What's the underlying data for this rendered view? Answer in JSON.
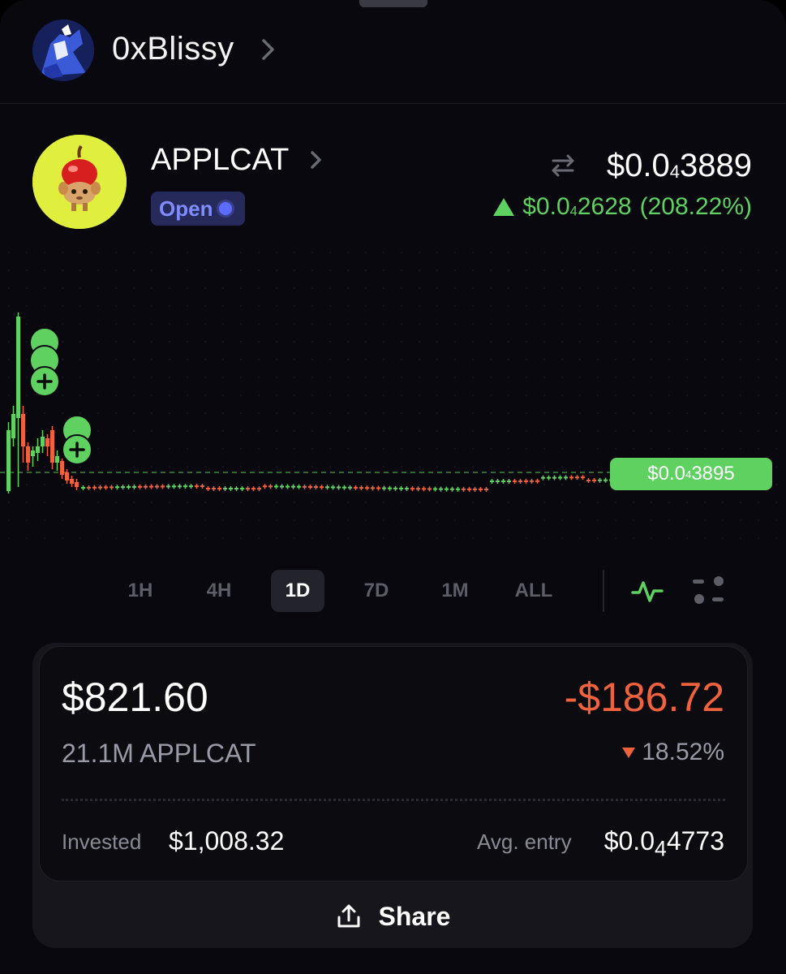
{
  "header": {
    "username": "0xBlissy",
    "avatar_icon": "user-avatar",
    "chevron_icon": "chevron-right-icon"
  },
  "token": {
    "name": "APPLCAT",
    "status": "Open",
    "logo_icon": "apple-cat-token-logo",
    "price_prefix": "$0.0",
    "price_zeros": "4",
    "price_digits": "3889",
    "change_prefix": "$0.0",
    "change_zeros": "4",
    "change_digits": "2628",
    "change_pct": "(208.22%)",
    "change_direction": "up"
  },
  "chart_data": {
    "type": "candlestick",
    "current_price_label_prefix": "$0.0",
    "current_price_label_zeros": "4",
    "current_price_label_digits": "3895",
    "buy_marker_count": 5,
    "up_color": "#5ed160",
    "down_color": "#f0623e"
  },
  "ranges": {
    "items": [
      "1H",
      "4H",
      "1D",
      "7D",
      "1M",
      "ALL"
    ],
    "active": "1D"
  },
  "position": {
    "value": "$821.60",
    "pnl": "-$186.72",
    "holdings": "21.1M APPLCAT",
    "pnl_pct": "18.52%",
    "invested_label": "Invested",
    "invested_value": "$1,008.32",
    "avg_entry_label": "Avg. entry",
    "avg_entry_prefix": "$0.0",
    "avg_entry_zeros": "4",
    "avg_entry_digits": "4773"
  },
  "share": {
    "label": "Share",
    "icon": "share-icon"
  },
  "colors": {
    "background": "#08080e",
    "positive": "#5ed160",
    "negative": "#f0623e",
    "badge_text": "#7f8cff"
  }
}
